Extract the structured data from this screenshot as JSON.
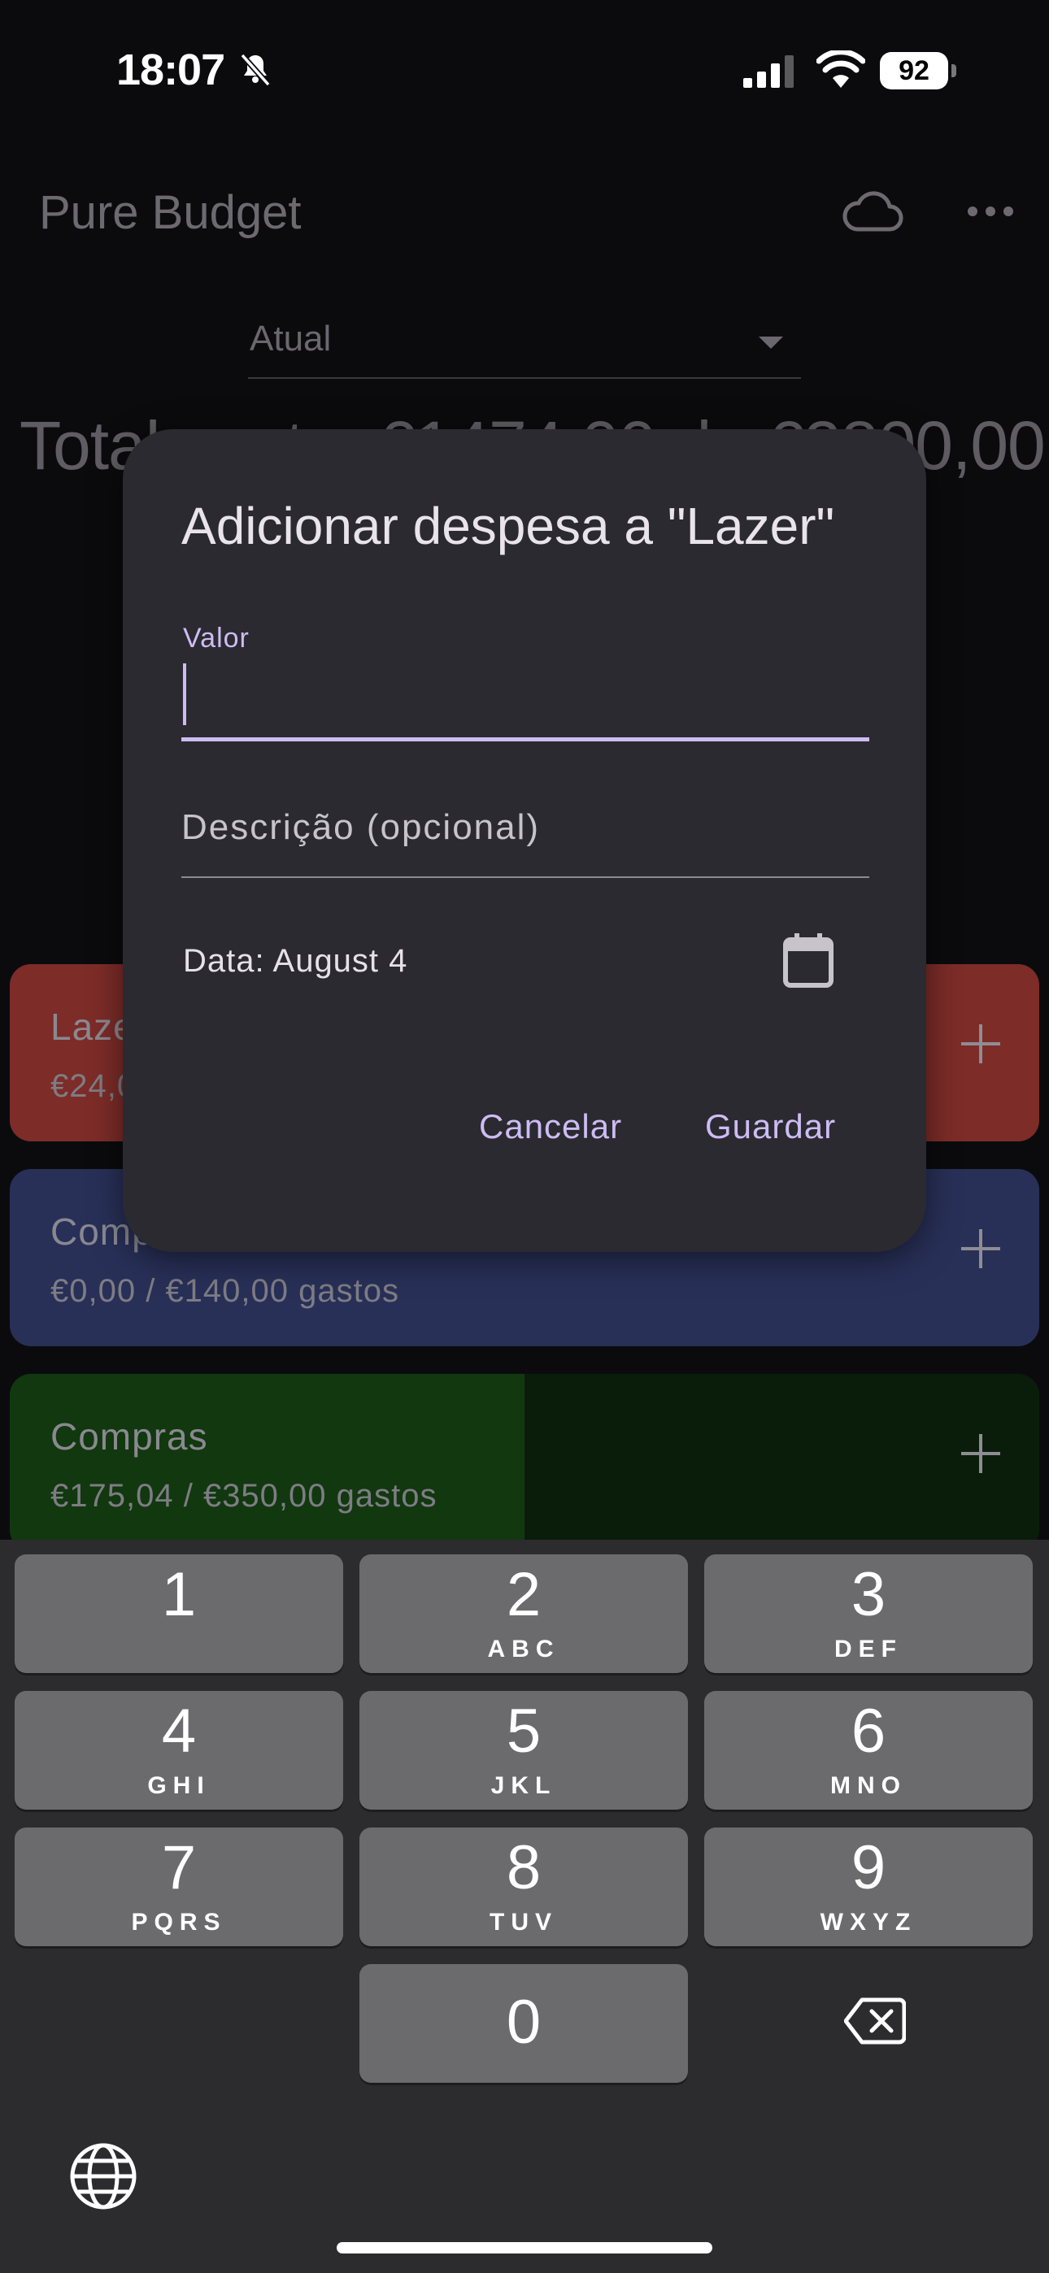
{
  "status_bar": {
    "time": "18:07",
    "battery": "92"
  },
  "app_bar": {
    "title": "Pure Budget"
  },
  "period_select": {
    "value": "Atual"
  },
  "summary": {
    "total_text": "Total gasto: €1474,00 de €2800,00"
  },
  "categories": [
    {
      "name": "Lazer",
      "amount": "€24,00 / €120,00 gastos"
    },
    {
      "name": "Compras",
      "amount": "€0,00 / €140,00 gastos"
    },
    {
      "name": "Compras",
      "amount": "€175,04 / €350,00 gastos",
      "progress": 0.5
    }
  ],
  "dialog": {
    "title": "Adicionar despesa a \"Lazer\"",
    "valor_label": "Valor",
    "valor_value": "",
    "description_placeholder": "Descrição (opcional)",
    "date_text": "Data: August 4",
    "cancel_label": "Cancelar",
    "save_label": "Guardar"
  },
  "keypad": {
    "keys": [
      {
        "digit": "1",
        "letters": ""
      },
      {
        "digit": "2",
        "letters": "ABC"
      },
      {
        "digit": "3",
        "letters": "DEF"
      },
      {
        "digit": "4",
        "letters": "GHI"
      },
      {
        "digit": "5",
        "letters": "JKL"
      },
      {
        "digit": "6",
        "letters": "MNO"
      },
      {
        "digit": "7",
        "letters": "PQRS"
      },
      {
        "digit": "8",
        "letters": "TUV"
      },
      {
        "digit": "9",
        "letters": "WXYZ"
      },
      {
        "digit": "0",
        "letters": ""
      }
    ]
  },
  "colors": {
    "accent": "#cdbcf4",
    "dialog_bg": "#2b2a30",
    "lazer_card": "#7d2c28",
    "compras_blue_card": "#283058",
    "compras_green_card": "#11380f"
  }
}
